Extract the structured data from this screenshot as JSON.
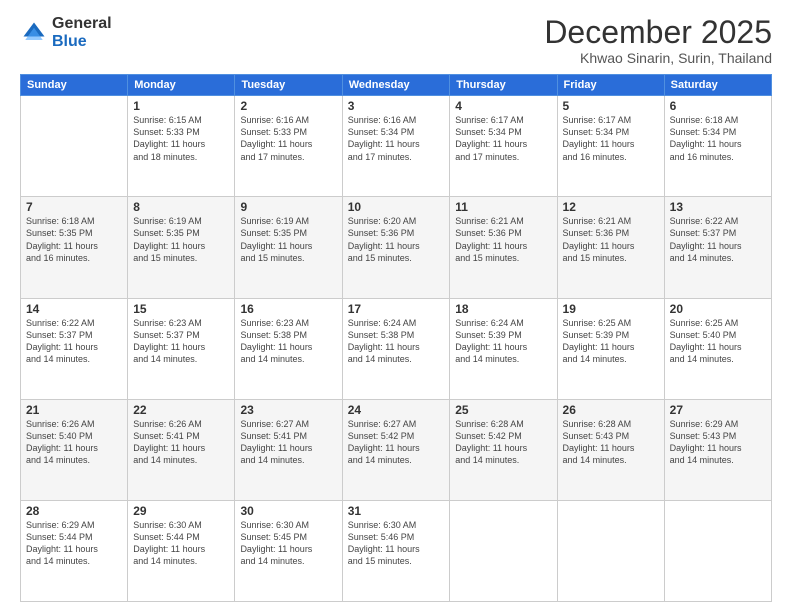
{
  "logo": {
    "general": "General",
    "blue": "Blue"
  },
  "title": "December 2025",
  "subtitle": "Khwao Sinarin, Surin, Thailand",
  "headers": [
    "Sunday",
    "Monday",
    "Tuesday",
    "Wednesday",
    "Thursday",
    "Friday",
    "Saturday"
  ],
  "weeks": [
    [
      {
        "day": "",
        "info": ""
      },
      {
        "day": "1",
        "info": "Sunrise: 6:15 AM\nSunset: 5:33 PM\nDaylight: 11 hours\nand 18 minutes."
      },
      {
        "day": "2",
        "info": "Sunrise: 6:16 AM\nSunset: 5:33 PM\nDaylight: 11 hours\nand 17 minutes."
      },
      {
        "day": "3",
        "info": "Sunrise: 6:16 AM\nSunset: 5:34 PM\nDaylight: 11 hours\nand 17 minutes."
      },
      {
        "day": "4",
        "info": "Sunrise: 6:17 AM\nSunset: 5:34 PM\nDaylight: 11 hours\nand 17 minutes."
      },
      {
        "day": "5",
        "info": "Sunrise: 6:17 AM\nSunset: 5:34 PM\nDaylight: 11 hours\nand 16 minutes."
      },
      {
        "day": "6",
        "info": "Sunrise: 6:18 AM\nSunset: 5:34 PM\nDaylight: 11 hours\nand 16 minutes."
      }
    ],
    [
      {
        "day": "7",
        "info": "Sunrise: 6:18 AM\nSunset: 5:35 PM\nDaylight: 11 hours\nand 16 minutes."
      },
      {
        "day": "8",
        "info": "Sunrise: 6:19 AM\nSunset: 5:35 PM\nDaylight: 11 hours\nand 15 minutes."
      },
      {
        "day": "9",
        "info": "Sunrise: 6:19 AM\nSunset: 5:35 PM\nDaylight: 11 hours\nand 15 minutes."
      },
      {
        "day": "10",
        "info": "Sunrise: 6:20 AM\nSunset: 5:36 PM\nDaylight: 11 hours\nand 15 minutes."
      },
      {
        "day": "11",
        "info": "Sunrise: 6:21 AM\nSunset: 5:36 PM\nDaylight: 11 hours\nand 15 minutes."
      },
      {
        "day": "12",
        "info": "Sunrise: 6:21 AM\nSunset: 5:36 PM\nDaylight: 11 hours\nand 15 minutes."
      },
      {
        "day": "13",
        "info": "Sunrise: 6:22 AM\nSunset: 5:37 PM\nDaylight: 11 hours\nand 14 minutes."
      }
    ],
    [
      {
        "day": "14",
        "info": "Sunrise: 6:22 AM\nSunset: 5:37 PM\nDaylight: 11 hours\nand 14 minutes."
      },
      {
        "day": "15",
        "info": "Sunrise: 6:23 AM\nSunset: 5:37 PM\nDaylight: 11 hours\nand 14 minutes."
      },
      {
        "day": "16",
        "info": "Sunrise: 6:23 AM\nSunset: 5:38 PM\nDaylight: 11 hours\nand 14 minutes."
      },
      {
        "day": "17",
        "info": "Sunrise: 6:24 AM\nSunset: 5:38 PM\nDaylight: 11 hours\nand 14 minutes."
      },
      {
        "day": "18",
        "info": "Sunrise: 6:24 AM\nSunset: 5:39 PM\nDaylight: 11 hours\nand 14 minutes."
      },
      {
        "day": "19",
        "info": "Sunrise: 6:25 AM\nSunset: 5:39 PM\nDaylight: 11 hours\nand 14 minutes."
      },
      {
        "day": "20",
        "info": "Sunrise: 6:25 AM\nSunset: 5:40 PM\nDaylight: 11 hours\nand 14 minutes."
      }
    ],
    [
      {
        "day": "21",
        "info": "Sunrise: 6:26 AM\nSunset: 5:40 PM\nDaylight: 11 hours\nand 14 minutes."
      },
      {
        "day": "22",
        "info": "Sunrise: 6:26 AM\nSunset: 5:41 PM\nDaylight: 11 hours\nand 14 minutes."
      },
      {
        "day": "23",
        "info": "Sunrise: 6:27 AM\nSunset: 5:41 PM\nDaylight: 11 hours\nand 14 minutes."
      },
      {
        "day": "24",
        "info": "Sunrise: 6:27 AM\nSunset: 5:42 PM\nDaylight: 11 hours\nand 14 minutes."
      },
      {
        "day": "25",
        "info": "Sunrise: 6:28 AM\nSunset: 5:42 PM\nDaylight: 11 hours\nand 14 minutes."
      },
      {
        "day": "26",
        "info": "Sunrise: 6:28 AM\nSunset: 5:43 PM\nDaylight: 11 hours\nand 14 minutes."
      },
      {
        "day": "27",
        "info": "Sunrise: 6:29 AM\nSunset: 5:43 PM\nDaylight: 11 hours\nand 14 minutes."
      }
    ],
    [
      {
        "day": "28",
        "info": "Sunrise: 6:29 AM\nSunset: 5:44 PM\nDaylight: 11 hours\nand 14 minutes."
      },
      {
        "day": "29",
        "info": "Sunrise: 6:30 AM\nSunset: 5:44 PM\nDaylight: 11 hours\nand 14 minutes."
      },
      {
        "day": "30",
        "info": "Sunrise: 6:30 AM\nSunset: 5:45 PM\nDaylight: 11 hours\nand 14 minutes."
      },
      {
        "day": "31",
        "info": "Sunrise: 6:30 AM\nSunset: 5:46 PM\nDaylight: 11 hours\nand 15 minutes."
      },
      {
        "day": "",
        "info": ""
      },
      {
        "day": "",
        "info": ""
      },
      {
        "day": "",
        "info": ""
      }
    ]
  ]
}
